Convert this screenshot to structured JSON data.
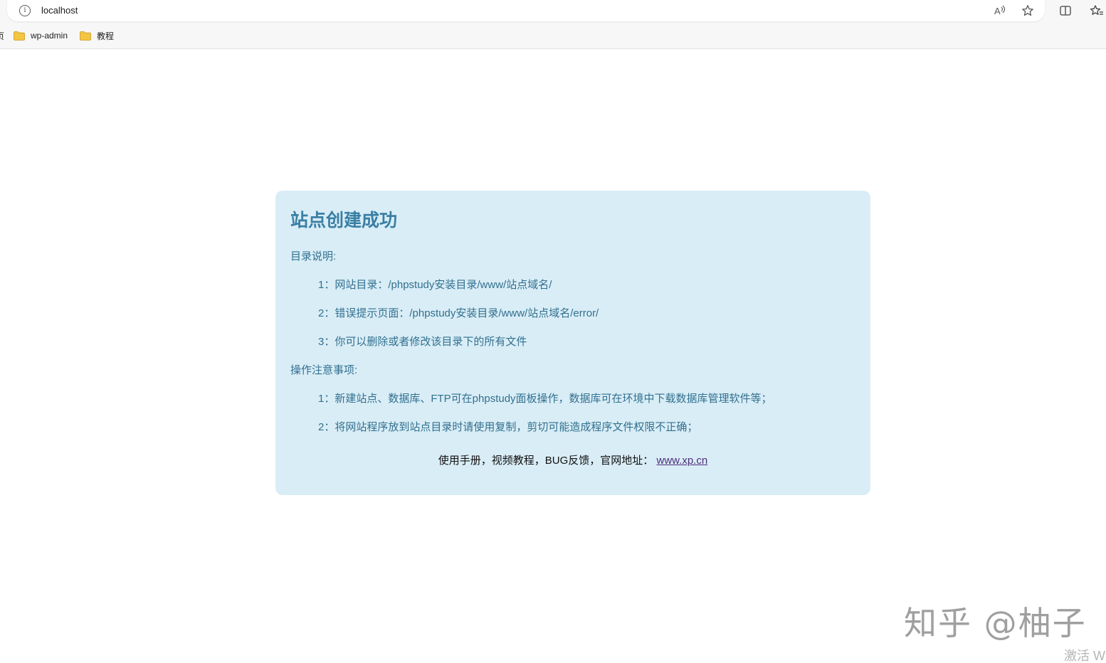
{
  "browser": {
    "url": "localhost",
    "info_icon": "i",
    "icons": [
      "read-aloud-icon",
      "favorite-star-icon",
      "split-screen-icon",
      "favorites-icon"
    ],
    "bookmarks": [
      {
        "label": "wp-admin"
      },
      {
        "label": "教程"
      }
    ],
    "bookmark_cut_label": "页"
  },
  "card": {
    "title": "站点创建成功",
    "dir_heading": "目录说明:",
    "dir_items": [
      "1：网站目录：/phpstudy安装目录/www/站点域名/",
      "2：错误提示页面：/phpstudy安装目录/www/站点域名/error/",
      "3：你可以删除或者修改该目录下的所有文件"
    ],
    "ops_heading": "操作注意事项:",
    "ops_items": [
      "1：新建站点、数据库、FTP可在phpstudy面板操作，数据库可在环境中下载数据库管理软件等；",
      "2：将网站程序放到站点目录时请使用复制，剪切可能造成程序文件权限不正确；"
    ],
    "footer_text": "使用手册，视频教程，BUG反馈，官网地址：",
    "footer_link": "www.xp.cn"
  },
  "watermarks": {
    "zhihu": "知乎 @柚子",
    "activate": "激活 W"
  },
  "colors": {
    "card_bg": "#d9edf6",
    "card_text": "#31708f",
    "title": "#3a7fa4",
    "link": "#4b2f7a"
  }
}
